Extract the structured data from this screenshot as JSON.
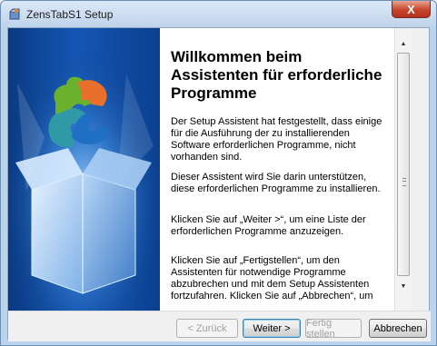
{
  "window": {
    "title": "ZensTabS1 Setup",
    "close_symbol": "X"
  },
  "content": {
    "heading": "Willkommen beim Assistenten für erforderliche Programme",
    "paragraphs": [
      "Der Setup Assistent hat festgestellt, dass einige für die Ausführung der zu installierenden Software erforderlichen Programme, nicht vorhanden sind.",
      "Dieser Assistent wird Sie darin unterstützen, diese erforderlichen Programme zu installieren.",
      "Klicken Sie auf „Weiter >“, um eine Liste der erforderlichen Programme anzuzeigen.",
      "Klicken Sie auf „Fertigstellen“, um den Assistenten für notwendige Programme abzubrechen und mit dem Setup Assistenten fortzufahren. Klicken Sie auf „Abbrechen“, um die"
    ]
  },
  "buttons": {
    "back": "< Zurück",
    "next": "Weiter >",
    "finish": "Fertig stellen",
    "cancel": "Abbrechen"
  },
  "colors": {
    "sidebar": "#1556b4",
    "accent": "#3c7fb1"
  },
  "icons": {
    "app": "setup-box-icon",
    "sidebar": "puzzle-box-graphic"
  }
}
